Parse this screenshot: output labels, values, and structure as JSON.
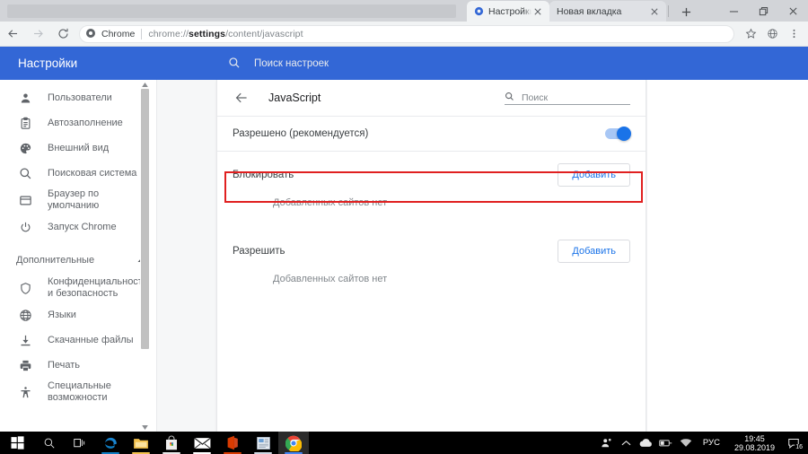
{
  "window": {
    "controls": {
      "minimize": "minimize-icon",
      "maximize": "restore-icon",
      "close": "close-icon"
    }
  },
  "tabs": [
    {
      "title": "Настройки – JavaSc",
      "favicon": "settings-gear-icon",
      "active": true,
      "close": "×"
    },
    {
      "title": "Новая вкладка",
      "favicon": "none",
      "active": false,
      "close": "×"
    }
  ],
  "newtab_label": "+",
  "toolbar": {
    "back": "back-arrow-icon",
    "forward": "forward-arrow-icon",
    "reload": "reload-icon",
    "omnibox": {
      "site_icon": "chrome-settings-icon",
      "chip": "Chrome",
      "url_prefix": "chrome://",
      "url_bold": "settings",
      "url_suffix": "/content/javascript"
    },
    "bookmark": "star-icon",
    "extension": "globe-icon",
    "menu": "three-dot-menu-icon"
  },
  "settings": {
    "brand": "Настройки",
    "search_placeholder": "Поиск настроек",
    "search_icon": "search-icon",
    "sidebar": [
      {
        "label": "Пользователи",
        "icon": "person-icon"
      },
      {
        "label": "Автозаполнение",
        "icon": "clipboard-icon"
      },
      {
        "label": "Внешний вид",
        "icon": "palette-icon"
      },
      {
        "label": "Поисковая система",
        "icon": "search-icon"
      },
      {
        "label": "Браузер по умолчанию",
        "icon": "browser-window-icon"
      },
      {
        "label": "Запуск Chrome",
        "icon": "power-icon"
      }
    ],
    "advanced_group": {
      "label": "Дополнительные",
      "icon": "chevron-up-icon"
    },
    "advanced_items": [
      {
        "label": "Конфиденциальность и безопасность",
        "icon": "shield-icon"
      },
      {
        "label": "Языки",
        "icon": "globe-icon"
      },
      {
        "label": "Скачанные файлы",
        "icon": "download-icon"
      },
      {
        "label": "Печать",
        "icon": "printer-icon"
      },
      {
        "label": "Специальные возможности",
        "icon": "accessibility-icon"
      }
    ]
  },
  "content": {
    "back_icon": "back-arrow-icon",
    "title": "JavaScript",
    "mini_search_placeholder": "Поиск",
    "mini_search_icon": "search-icon",
    "toggle": {
      "label": "Разрешено (рекомендуется)",
      "on": true
    },
    "highlight_color": "#e02020",
    "accent_color": "#1a73e8",
    "sections": [
      {
        "title": "Блокировать",
        "button": "Добавить",
        "empty": "Добавленных сайтов нет"
      },
      {
        "title": "Разрешить",
        "button": "Добавить",
        "empty": "Добавленных сайтов нет"
      }
    ]
  },
  "taskbar": {
    "start": "windows-logo-icon",
    "search": "search-icon",
    "taskview": "task-view-icon",
    "apps": [
      {
        "name": "edge-icon",
        "color": "#0f7dc2",
        "active": false
      },
      {
        "name": "file-explorer-icon",
        "color": "#f2c14e",
        "active": false
      },
      {
        "name": "microsoft-store-icon",
        "color": "#e8e8e8",
        "active": false
      },
      {
        "name": "mail-icon",
        "color": "#ffffff",
        "active": false
      },
      {
        "name": "office-icon",
        "color": "#d83b01",
        "active": false
      },
      {
        "name": "news-reader-icon",
        "color": "#cfd8e3",
        "active": false
      },
      {
        "name": "chrome-icon",
        "color": "#4285f4",
        "active": true
      }
    ],
    "tray": {
      "people": "people-icon",
      "chevron": "show-hidden-icons-icon",
      "onedrive": "cloud-icon",
      "hardware": "removable-media-icon",
      "network": "wifi-icon",
      "language": "РУС",
      "time": "19:45",
      "date": "29.08.2019",
      "notifications_icon": "action-center-icon",
      "notifications_count": "16"
    }
  }
}
